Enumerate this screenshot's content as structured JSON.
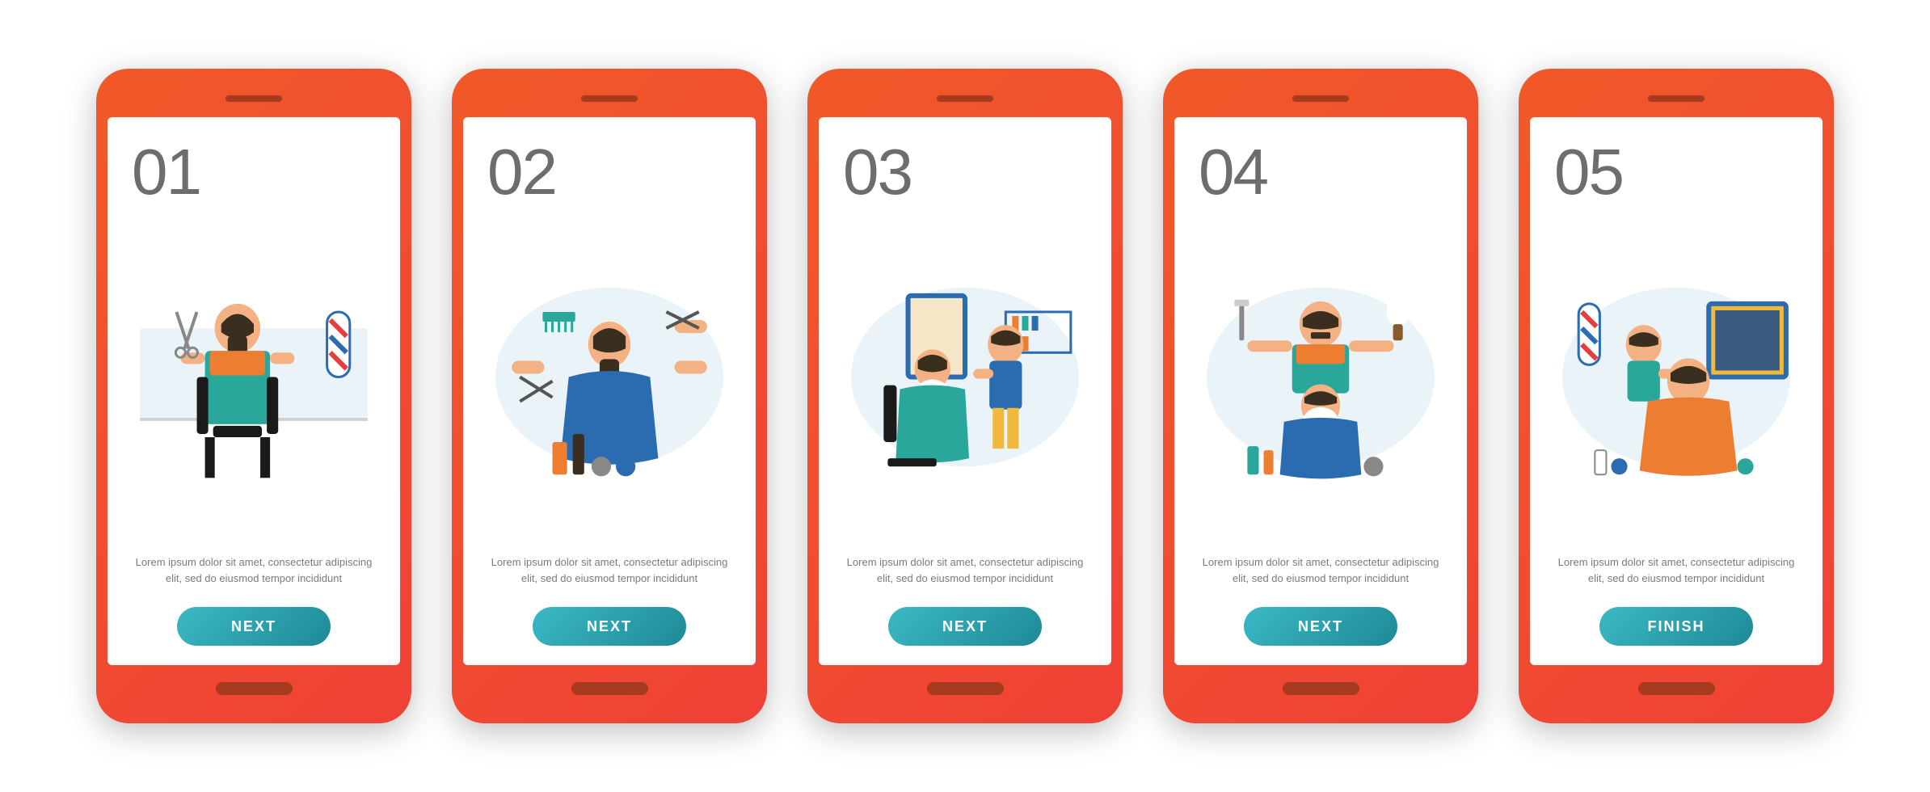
{
  "screens": [
    {
      "number": "01",
      "description": "Lorem ipsum dolor sit amet, consectetur adipiscing elit, sed do eiusmod tempor incididunt",
      "button": "NEXT"
    },
    {
      "number": "02",
      "description": "Lorem ipsum dolor sit amet, consectetur adipiscing elit, sed do eiusmod tempor incididunt",
      "button": "NEXT"
    },
    {
      "number": "03",
      "description": "Lorem ipsum dolor sit amet, consectetur adipiscing elit, sed do eiusmod tempor incididunt",
      "button": "NEXT"
    },
    {
      "number": "04",
      "description": "Lorem ipsum dolor sit amet, consectetur adipiscing elit, sed do eiusmod tempor incididunt",
      "button": "NEXT"
    },
    {
      "number": "05",
      "description": "Lorem ipsum dolor sit amet, consectetur adipiscing elit, sed do eiusmod tempor incididunt",
      "button": "FINISH"
    }
  ],
  "colors": {
    "phoneGradientStart": "#f15a29",
    "phoneGradientEnd": "#ef4136",
    "buttonGradientStart": "#3bb9c5",
    "buttonGradientEnd": "#1e8a96",
    "stepNumber": "#6d6d6d",
    "description": "#7a7a7a"
  }
}
